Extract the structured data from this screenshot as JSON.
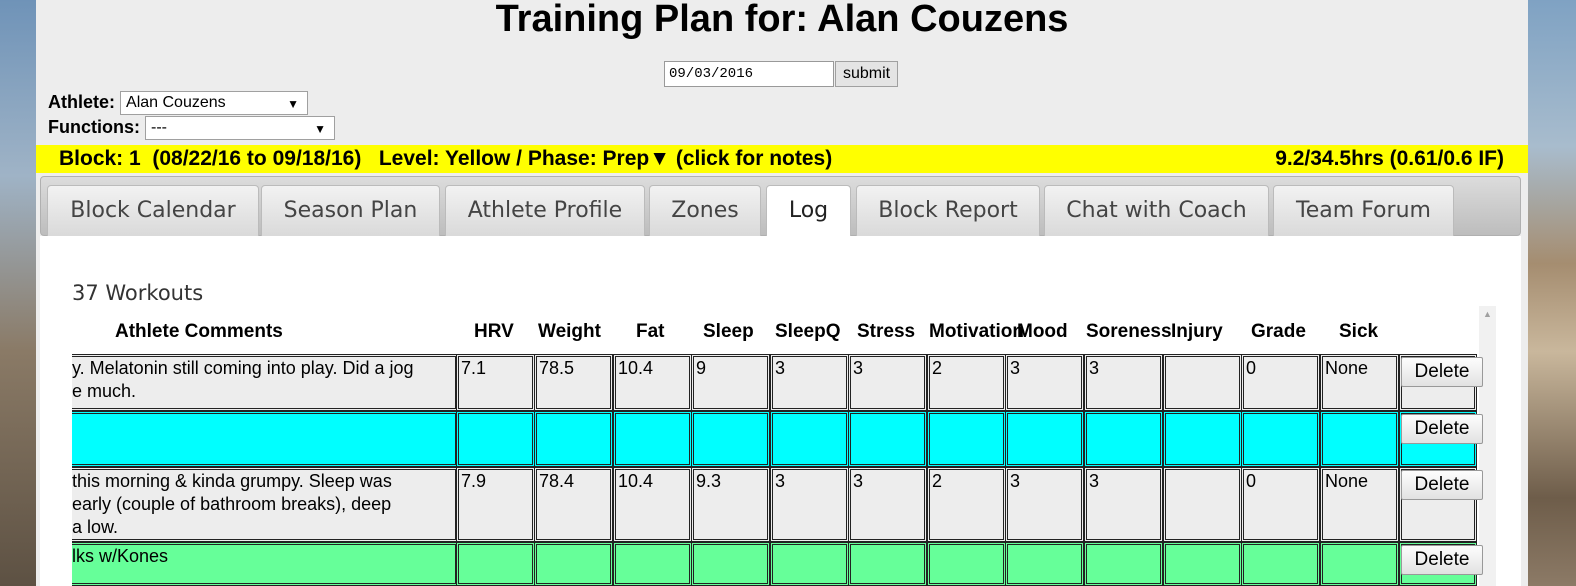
{
  "title": "Training Plan for: Alan Couzens",
  "date_form": {
    "date_value": "09/03/2016",
    "submit_label": "submit"
  },
  "athlete_field": {
    "label": "Athlete:",
    "selected": "Alan Couzens"
  },
  "functions_field": {
    "label": "Functions:",
    "selected": "---"
  },
  "block_bar": {
    "left_text": "Block: 1  (08/22/16 to 09/18/16)   Level: Yellow / Phase: Prep▼ (click for notes)",
    "right_text": "9.2/34.5hrs (0.61/0.6 IF)",
    "color": "#ffff00"
  },
  "tabs": [
    {
      "label": "Block Calendar",
      "active": false
    },
    {
      "label": "Season Plan",
      "active": false
    },
    {
      "label": "Athlete Profile",
      "active": false
    },
    {
      "label": "Zones",
      "active": false
    },
    {
      "label": "Log",
      "active": true
    },
    {
      "label": "Block Report",
      "active": false
    },
    {
      "label": "Chat with Coach",
      "active": false
    },
    {
      "label": "Team Forum",
      "active": false
    }
  ],
  "log": {
    "count_text": "37 Workouts",
    "columns": [
      "Athlete Comments",
      "HRV",
      "Weight",
      "Fat",
      "Sleep",
      "SleepQ",
      "Stress",
      "Motivation",
      "Mood",
      "Soreness",
      "Injury",
      "Grade",
      "Sick"
    ],
    "delete_label": "Delete",
    "rows": [
      {
        "comment": "y. Melatonin still coming into play. Did a jog\ne much.",
        "values": [
          "7.1",
          "78.5",
          "10.4",
          "9",
          "3",
          "3",
          "2",
          "3",
          "3",
          "",
          "0",
          "None"
        ],
        "color": "#ededed"
      },
      {
        "comment": "",
        "values": [
          "",
          "",
          "",
          "",
          "",
          "",
          "",
          "",
          "",
          "",
          "",
          ""
        ],
        "color": "#00ffff"
      },
      {
        "comment": "this morning & kinda grumpy. Sleep was\nearly (couple of bathroom breaks), deep\na low.",
        "values": [
          "7.9",
          "78.4",
          "10.4",
          "9.3",
          "3",
          "3",
          "2",
          "3",
          "3",
          "",
          "0",
          "None"
        ],
        "color": "#ededed"
      },
      {
        "comment": "lks w/Kones",
        "values": [
          "",
          "",
          "",
          "",
          "",
          "",
          "",
          "",
          "",
          "",
          "",
          ""
        ],
        "color": "#66ff99"
      }
    ]
  }
}
